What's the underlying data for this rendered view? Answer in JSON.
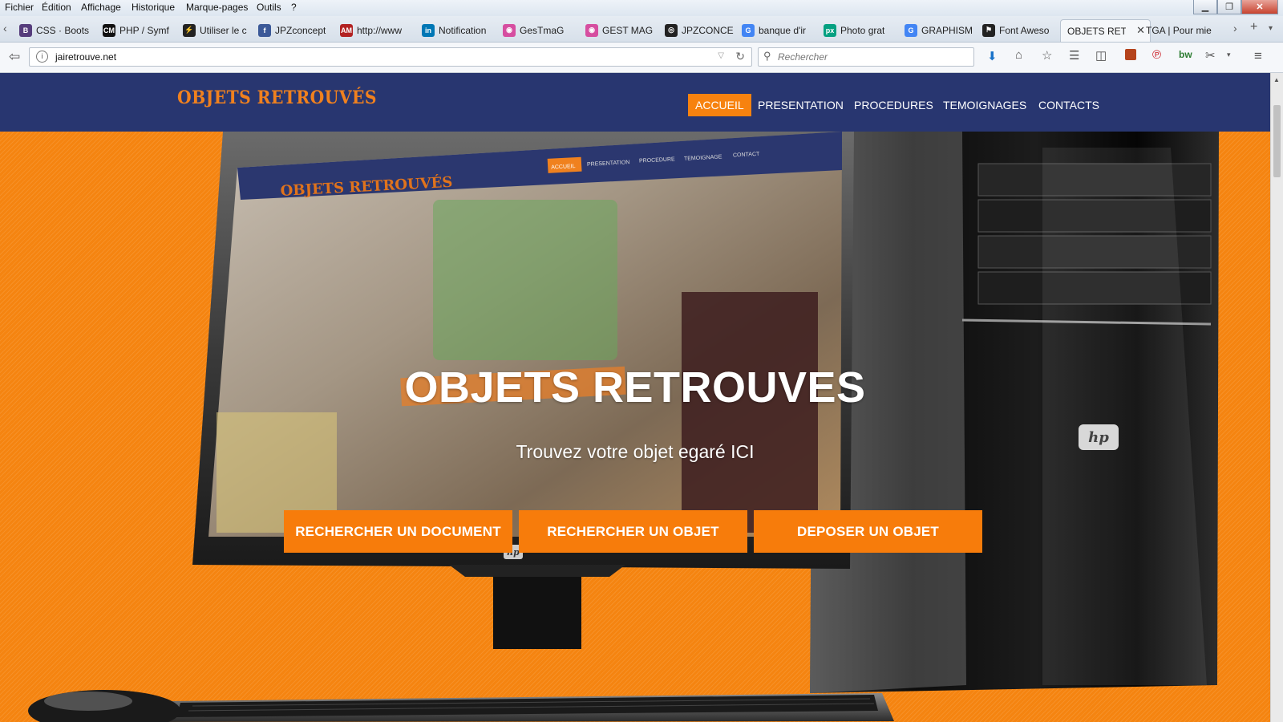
{
  "menubar": {
    "items": [
      "Fichier",
      "Édition",
      "Affichage",
      "Historique",
      "Marque-pages",
      "Outils",
      "?"
    ]
  },
  "tabs": [
    {
      "label": "CSS · Boots",
      "favicon": "B",
      "color": "#563d7c"
    },
    {
      "label": "PHP / Symf",
      "favicon": "CM",
      "color": "#111111"
    },
    {
      "label": "Utiliser le c",
      "favicon": "⚡",
      "color": "#222222"
    },
    {
      "label": "JPZconcept",
      "favicon": "f",
      "color": "#3b5998"
    },
    {
      "label": "http://www",
      "favicon": "AM",
      "color": "#b22222"
    },
    {
      "label": "Notification",
      "favicon": "in",
      "color": "#0077b5"
    },
    {
      "label": "GesTmaG",
      "favicon": "◉",
      "color": "#d64ea0"
    },
    {
      "label": "GEST MAG",
      "favicon": "◉",
      "color": "#d64ea0"
    },
    {
      "label": "JPZCONCE",
      "favicon": "◎",
      "color": "#222222"
    },
    {
      "label": "banque d'ir",
      "favicon": "G",
      "color": "#4285f4"
    },
    {
      "label": "Photo grat",
      "favicon": "px",
      "color": "#05a081"
    },
    {
      "label": "GRAPHISM",
      "favicon": "G",
      "color": "#4285f4"
    },
    {
      "label": "Font Aweso",
      "favicon": "⚑",
      "color": "#222222"
    },
    {
      "label": "OBJETS RETI",
      "favicon": "",
      "color": "#f5f7fa"
    },
    {
      "label": "TGA | Pour mie",
      "favicon": "",
      "color": "#f5f7fa"
    }
  ],
  "navbar": {
    "url": "jairetrouve.net",
    "search_placeholder": "Rechercher"
  },
  "site": {
    "logo": "OBJETS RETROUVÉS",
    "nav": [
      "ACCUEIL",
      "PRESENTATION",
      "PROCEDURES",
      "TEMOIGNAGES",
      "CONTACTS"
    ],
    "active_nav": "ACCUEIL",
    "hero_title": "OBJETS RETROUVES",
    "hero_subtitle": "Trouvez votre objet egaré ICI",
    "cta": [
      "RECHERCHER UN DOCUMENT",
      "RECHERCHER UN OBJET",
      "DEPOSER UN OBJET"
    ],
    "slide_count": 3,
    "active_slide": 3,
    "accent_color": "#f7820f",
    "header_color": "#283670"
  },
  "screen_mock": {
    "logo": "OBJETS RETROUVÉS",
    "nav": [
      "ACCUEIL",
      "PRESENTATION",
      "PROCEDURE",
      "TEMOIGNAGE",
      "CONTACT"
    ]
  }
}
